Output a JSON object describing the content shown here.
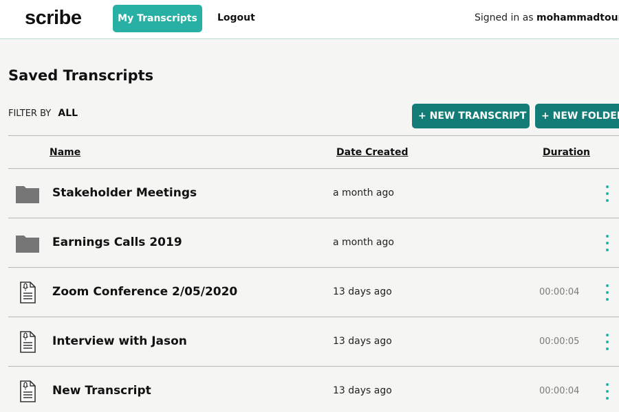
{
  "header": {
    "logo": "scribe",
    "nav_my_transcripts": "My Transcripts",
    "nav_logout": "Logout",
    "signed_in_prefix": "Signed in as",
    "username": "mohammadtour"
  },
  "page": {
    "title": "Saved Transcripts",
    "filter_label": "FILTER BY",
    "filter_value": "ALL",
    "new_transcript_label": "+ NEW TRANSCRIPT",
    "new_folder_label": "+ NEW FOLDER"
  },
  "table": {
    "columns": {
      "name": "Name",
      "date_created": "Date Created",
      "duration": "Duration"
    },
    "rows": [
      {
        "type": "folder",
        "icon": "folder-icon",
        "name": "Stakeholder Meetings",
        "date": "a month ago",
        "duration": ""
      },
      {
        "type": "folder",
        "icon": "folder-icon",
        "name": "Earnings Calls 2019",
        "date": "a month ago",
        "duration": ""
      },
      {
        "type": "transcript",
        "icon": "transcript-file-icon",
        "name": "Zoom Conference 2/05/2020",
        "date": "13 days ago",
        "duration": "00:00:04"
      },
      {
        "type": "transcript",
        "icon": "transcript-file-icon",
        "name": "Interview with Jason",
        "date": "13 days ago",
        "duration": "00:00:05"
      },
      {
        "type": "transcript",
        "icon": "transcript-file-icon",
        "name": "New Transcript",
        "date": "13 days ago",
        "duration": "00:00:04"
      }
    ]
  },
  "colors": {
    "accent": "#27b0a3",
    "button": "#137c77",
    "folder_icon": "#767676"
  }
}
